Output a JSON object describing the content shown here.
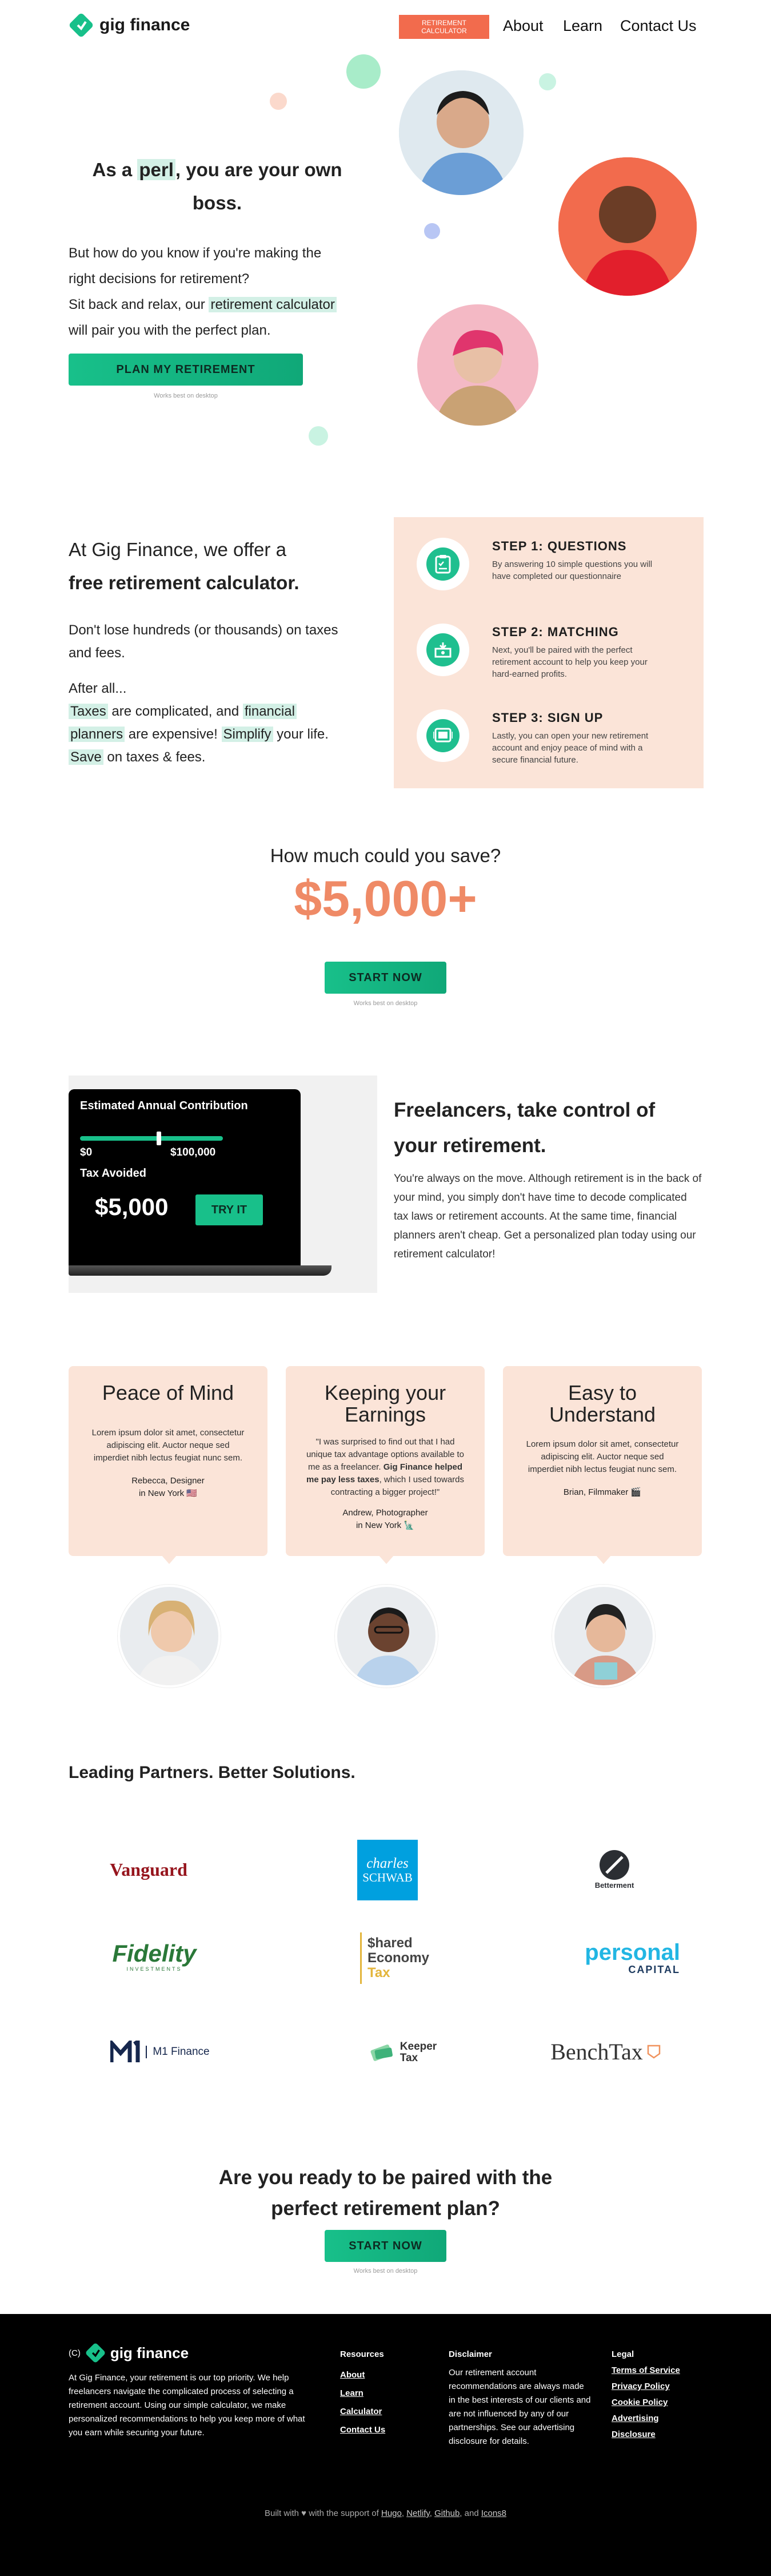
{
  "nav": {
    "brand": "gig finance",
    "cta": "RETIREMENT CALCULATOR",
    "links": [
      "About",
      "Learn",
      "Contact Us"
    ]
  },
  "hero": {
    "title_pre": "As a ",
    "title_word": "perl",
    "title_post": ", you are your own",
    "title_line2": "boss.",
    "body_line1": "But how do you know if you're making the",
    "body_line2": "right decisions for retirement?",
    "body_line3_pre": "Sit back and relax, our ",
    "body_line3_hl": "retirement calculator",
    "body_line4": "will pair you with the perfect plan.",
    "button": "PLAN MY RETIREMENT",
    "note": "Works best on desktop"
  },
  "offer": {
    "heading_line1": "At Gig Finance, we offer a",
    "heading_line2": "free retirement calculator.",
    "p1_line1": "Don't lose hundreds (or thousands) on taxes",
    "p1_line2": "and fees.",
    "after": "After all...",
    "taxes": "Taxes",
    "complicated": " are complicated, and ",
    "financial": "financial",
    "planners": "planners",
    "expensive": " are expensive! ",
    "simplify": "Simplify",
    "your_life": " your life.",
    "save": "Save",
    "save_rest": " on taxes & fees.",
    "steps": [
      {
        "title": "STEP 1: QUESTIONS",
        "desc": "By answering 10 simple questions you will have completed our questionnaire",
        "icon": "clipboard-icon"
      },
      {
        "title": "STEP 2: MATCHING",
        "desc": "Next, you'll be paired with the perfect retirement account to help you keep your hard-earned profits.",
        "icon": "piggy-bank-icon"
      },
      {
        "title": "STEP 3: SIGN UP",
        "desc": "Lastly, you can open your new retirement account and enjoy peace of mind with a secure financial future.",
        "icon": "tablet-icon"
      }
    ]
  },
  "savings": {
    "question": "How much could you save?",
    "amount": "$5,000+",
    "button": "START NOW",
    "note": "Works best on desktop"
  },
  "calculator": {
    "title": "Estimated Annual Contribution",
    "min": "$0",
    "max": "$100,000",
    "slider_fraction": 0.55,
    "tax_avoided": "Tax Avoided",
    "result": "$5,000",
    "try": "TRY IT"
  },
  "freelancers": {
    "heading_line1": "Freelancers, take control of",
    "heading_line2": "your retirement.",
    "body": "You're always on the move. Although retirement is in the back of your mind, you simply don't have time to decode complicated tax laws or retirement accounts. At the same time, financial planners aren't cheap. Get a personalized plan today using our retirement calculator!"
  },
  "testimonials": [
    {
      "title": "Peace of Mind",
      "quote": "Lorem ipsum dolor sit amet, consectetur adipiscing elit. Auctor neque sed imperdiet nibh lectus feugiat nunc sem.",
      "who_line1": "Rebecca, Designer",
      "who_line2": "in New York 🇺🇸"
    },
    {
      "title": "Keeping your Earnings",
      "quote_pre": "\"I was surprised to find out that I had unique tax advantage options available to me as a freelancer. ",
      "quote_bold": "Gig Finance helped me pay less taxes",
      "quote_post": ", which I used towards contracting a bigger project!\"",
      "who_line1": "Andrew, Photographer",
      "who_line2": "in New York 🗽"
    },
    {
      "title": "Easy to Understand",
      "quote": "Lorem ipsum dolor sit amet, consectetur adipiscing elit. Auctor neque sed imperdiet nibh lectus feugiat nunc sem.",
      "who_line1": "Brian, Filmmaker 🎬",
      "who_line2": ""
    }
  ],
  "partners": {
    "heading": "Leading Partners. Better Solutions.",
    "logos": {
      "vanguard": "Vanguard",
      "schwab_1": "charles",
      "schwab_2": "SCHWAB",
      "betterment": "Betterment",
      "fidelity": "Fidelity",
      "fidelity_sub": "INVESTMENTS",
      "shared_1": "$hared",
      "shared_2": "Economy",
      "shared_3": "Tax",
      "personal_1": "personal",
      "personal_2": "CAPITAL",
      "m1": "M1 Finance",
      "keeper_1": "Keeper",
      "keeper_2": "Tax",
      "bench": "BenchTax"
    }
  },
  "final_cta": {
    "line1": "Are you ready to be paired with the",
    "line2": "perfect retirement plan?",
    "button": "START NOW",
    "note": "Works best on desktop"
  },
  "footer": {
    "copyright": "(C)",
    "brand": "gig finance",
    "about": "At Gig Finance, your retirement is our top priority. We help freelancers navigate the complicated process of selecting a retirement account. Using our simple calculator, we make personalized recommendations to help you keep more of what you earn while securing your future.",
    "resources_head": "Resources",
    "resources": [
      "About",
      "Learn",
      "Calculator",
      "Contact Us"
    ],
    "disclaimer_head": "Disclaimer",
    "disclaimer": "Our retirement account recommendations are always made in the best interests of our clients and are not influenced by any of our partnerships. See our advertising disclosure for details.",
    "legal_head": "Legal",
    "legal": [
      "Terms of Service",
      "Privacy Policy",
      "Cookie Policy",
      "Advertising",
      "Disclosure"
    ],
    "built_pre": "Built with ♥ with the support of ",
    "built_links": [
      "Hugo",
      "Netlify",
      "Github"
    ],
    "built_and": ", and ",
    "built_last": "Icons8"
  },
  "colors": {
    "accent_green": "#18c08a",
    "peach": "#fbe4d8",
    "salmon": "#ef8a66",
    "cta_orange": "#f26b4d"
  }
}
